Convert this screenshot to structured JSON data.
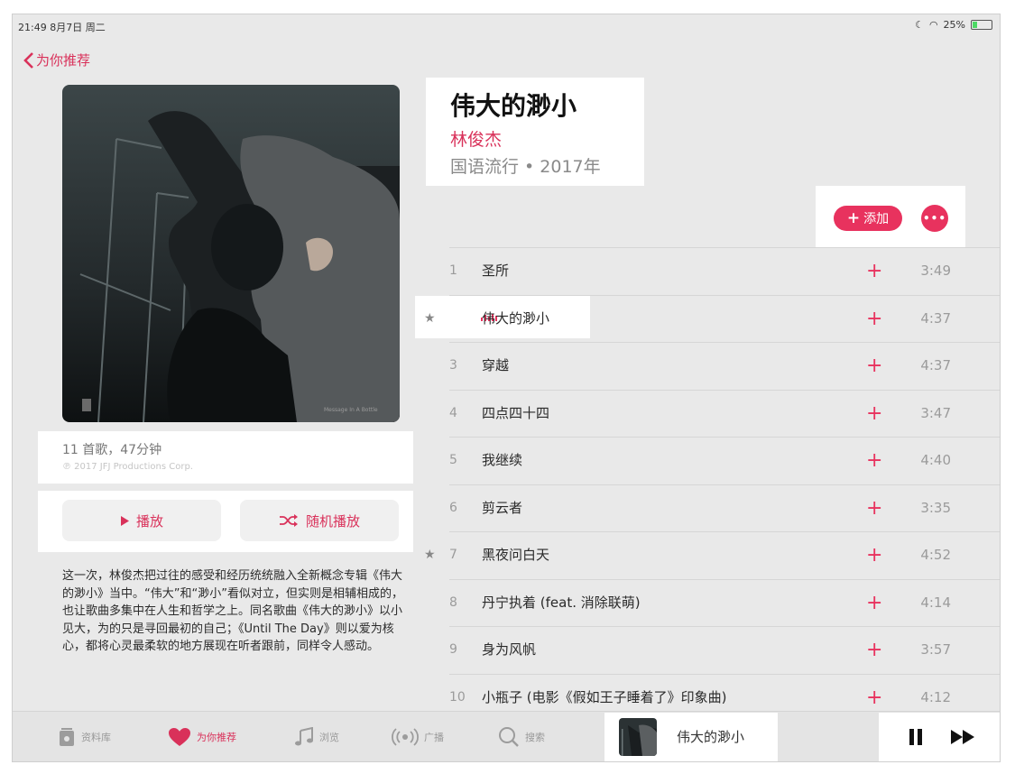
{
  "status_bar": {
    "time": "21:49  8月7日 周二",
    "battery": "25%",
    "battery_level": 0.25
  },
  "nav": {
    "back_label": "为你推荐"
  },
  "album": {
    "title": "伟大的渺小",
    "artist": "林俊杰",
    "genre_year": "国语流行 • 2017年",
    "summary": "11 首歌，47分钟",
    "copyright": "℗ 2017 JFJ Productions Corp.",
    "cover_caption": "Message In A Bottle",
    "description": "这一次，林俊杰把过往的感受和经历统统融入全新概念专辑《伟大的渺小》当中。“伟大”和“渺小”看似对立，但实则是相辅相成的，也让歌曲多集中在人生和哲学之上。同名歌曲《伟大的渺小》以小见大，为的只是寻回最初的自己；《Until The Day》则以爱为核心，都将心灵最柔软的地方展现在听者跟前，同样令人感动。"
  },
  "actions": {
    "play_label": "播放",
    "shuffle_label": "随机播放",
    "add_label": "添加",
    "more_label": "•••",
    "play_icon": "play-icon",
    "shuffle_icon": "shuffle-icon",
    "plus_symbol": "+"
  },
  "tracks": [
    {
      "num": "1",
      "name": "圣所",
      "duration": "3:49",
      "star": false
    },
    {
      "num": "",
      "name": "伟大的渺小",
      "duration": "4:37",
      "star": true,
      "playing": true
    },
    {
      "num": "3",
      "name": "穿越",
      "duration": "4:37",
      "star": false
    },
    {
      "num": "4",
      "name": "四点四十四",
      "duration": "3:47",
      "star": false
    },
    {
      "num": "5",
      "name": "我继续",
      "duration": "4:40",
      "star": false
    },
    {
      "num": "6",
      "name": "剪云者",
      "duration": "3:35",
      "star": false
    },
    {
      "num": "7",
      "name": "黑夜问白天",
      "duration": "4:52",
      "star": true
    },
    {
      "num": "8",
      "name": "丹宁执着 (feat. 消除联萌)",
      "duration": "4:14",
      "star": false
    },
    {
      "num": "9",
      "name": "身为风帆",
      "duration": "3:57",
      "star": false
    },
    {
      "num": "10",
      "name": "小瓶子 (电影《假如王子睡着了》印象曲)",
      "duration": "4:12",
      "star": false
    }
  ],
  "tab_bar": {
    "tabs": [
      {
        "label": "资料库",
        "icon": "library-icon"
      },
      {
        "label": "为你推荐",
        "icon": "heart-icon",
        "active": true
      },
      {
        "label": "浏览",
        "icon": "music-note-icon"
      },
      {
        "label": "广播",
        "icon": "radio-icon"
      },
      {
        "label": "搜索",
        "icon": "search-icon"
      }
    ]
  },
  "now_playing": {
    "title": "伟大的渺小"
  },
  "colors": {
    "accent": "#e8325e",
    "background": "#e9e9e9"
  }
}
